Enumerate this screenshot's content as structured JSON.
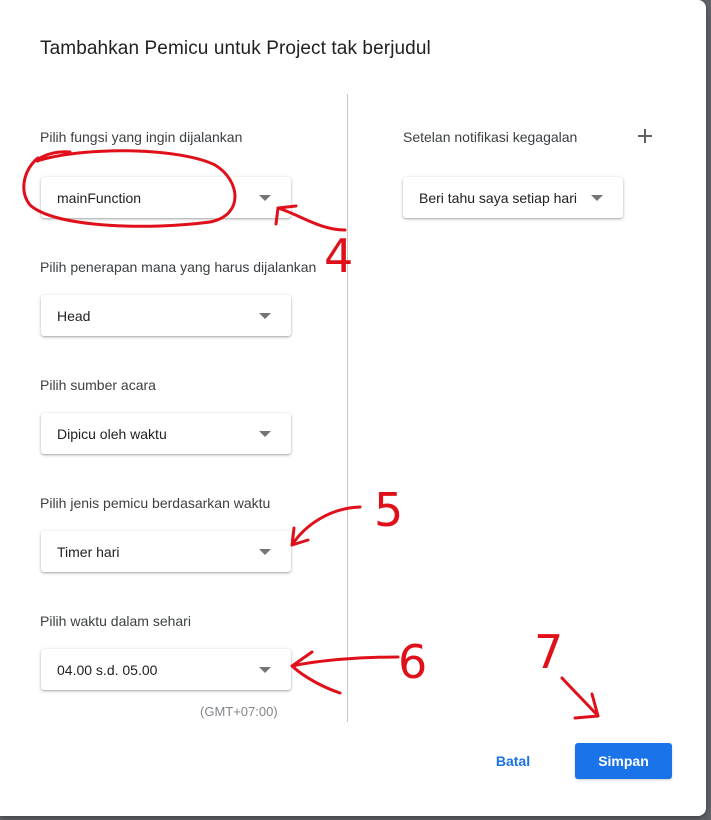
{
  "dialog": {
    "title": "Tambahkan Pemicu untuk Project tak berjudul"
  },
  "fields": {
    "function": {
      "label": "Pilih fungsi yang ingin dijalankan",
      "value": "mainFunction"
    },
    "deployment": {
      "label": "Pilih penerapan mana yang harus dijalankan",
      "value": "Head"
    },
    "event_source": {
      "label": "Pilih sumber acara",
      "value": "Dipicu oleh waktu"
    },
    "trigger_type": {
      "label": "Pilih jenis pemicu berdasarkan waktu",
      "value": "Timer hari"
    },
    "time_of_day": {
      "label": "Pilih waktu dalam sehari",
      "value": "04.00 s.d. 05.00",
      "timezone": "(GMT+07:00)"
    }
  },
  "notifications": {
    "label": "Setelan notifikasi kegagalan",
    "value": "Beri tahu saya setiap hari",
    "add_icon": "plus-icon"
  },
  "buttons": {
    "cancel": "Batal",
    "save": "Simpan"
  },
  "annotations": {
    "color": "#e0101a",
    "numbers": [
      "4",
      "5",
      "6",
      "7"
    ]
  },
  "colors": {
    "accent": "#1a73e8",
    "annotation_red": "#e0101a"
  }
}
